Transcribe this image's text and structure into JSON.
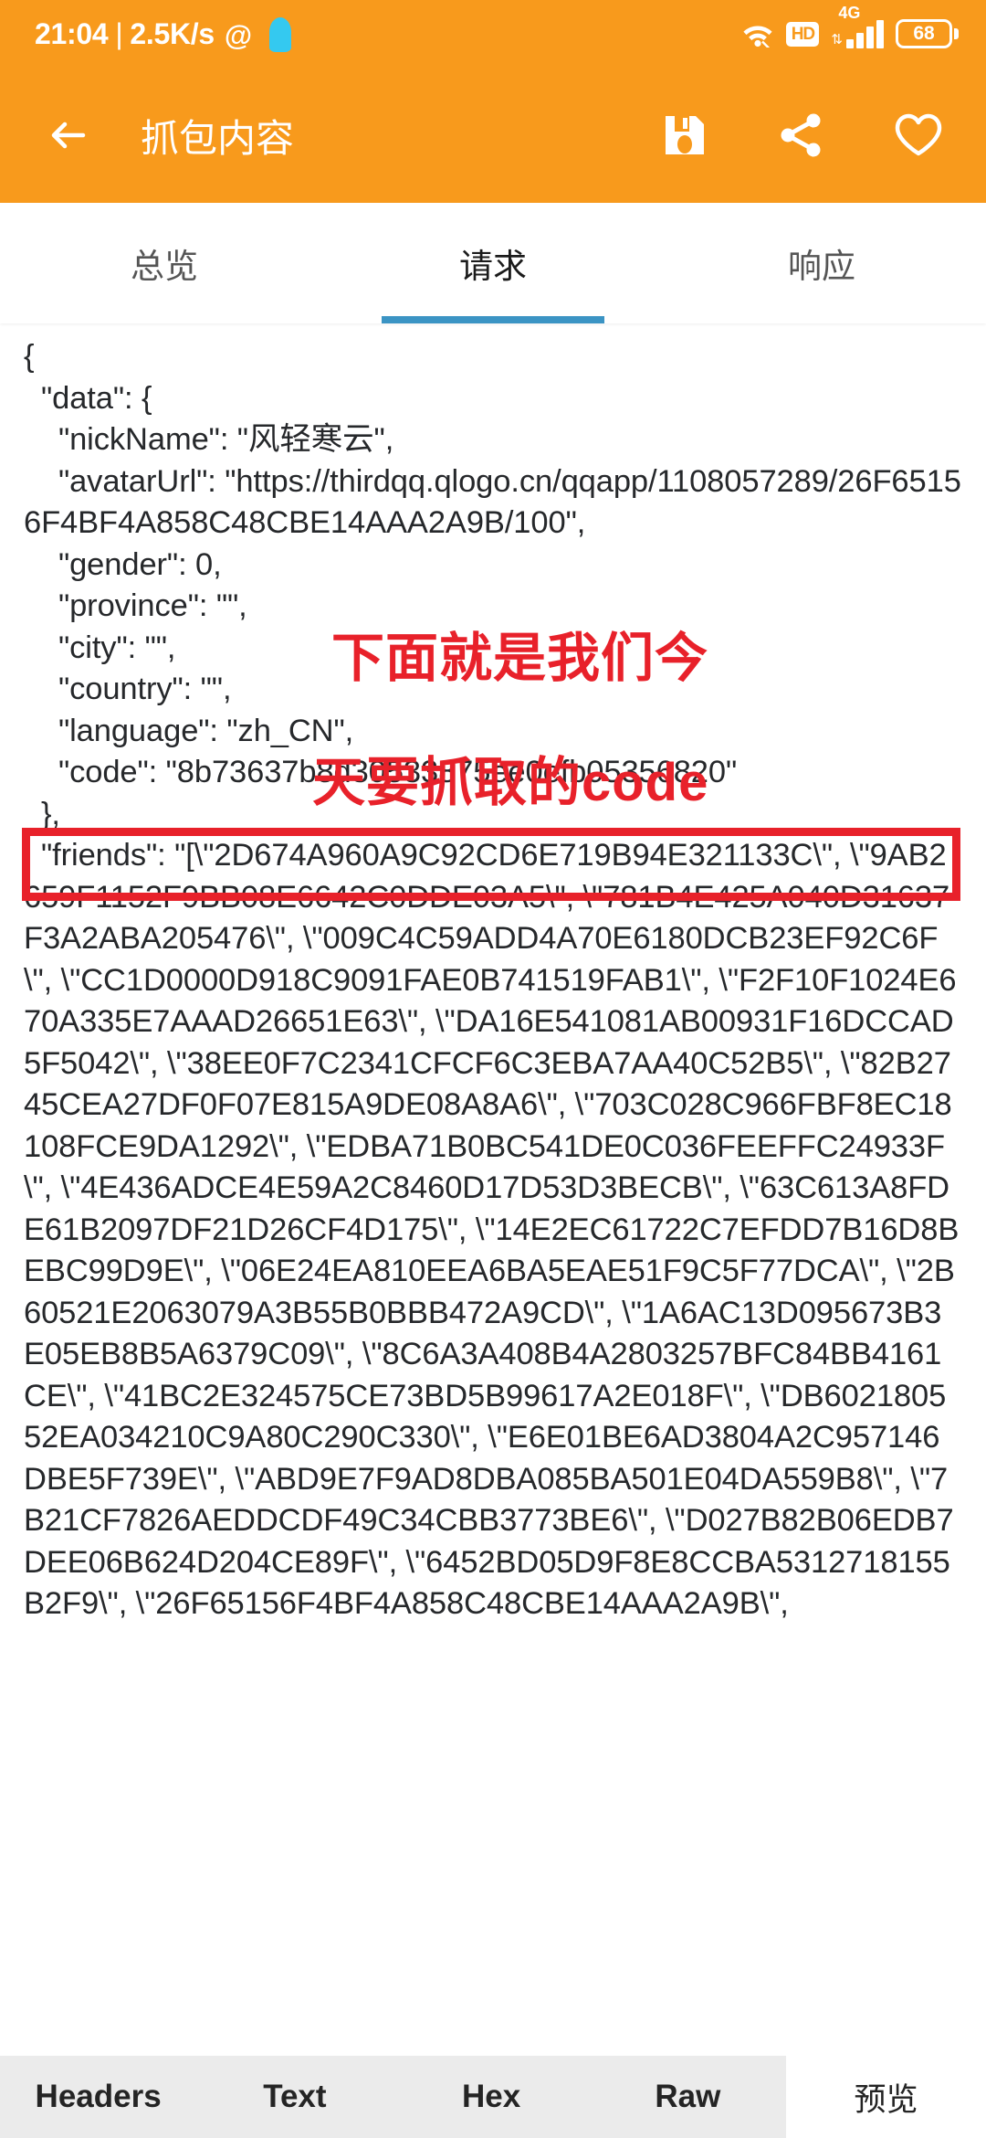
{
  "status_bar": {
    "time": "21:04",
    "separator": "|",
    "net_speed": "2.5K/s",
    "at_icon": "@",
    "qq_icon": "qq-penguin-icon",
    "wifi_icon": "wifi-icon",
    "hd_label": "HD",
    "network_type": "4G",
    "signal_icon": "signal-bars-icon",
    "battery_level": "68"
  },
  "app_bar": {
    "back_icon": "back-arrow-icon",
    "title": "抓包内容",
    "save_icon": "save-icon",
    "share_icon": "share-icon",
    "favorite_icon": "heart-icon"
  },
  "tabs": {
    "items": [
      {
        "label": "总览",
        "active": false
      },
      {
        "label": "请求",
        "active": true
      },
      {
        "label": "响应",
        "active": false
      }
    ],
    "active_index": 1,
    "indicator_color": "#3B94C4"
  },
  "annotations": {
    "color": "#E8212A",
    "line1": "下面就是我们今",
    "line2": "天要抓取的code",
    "highlight_target": "\"code\": \"8b73637b8d30533875ee0efb05356820\""
  },
  "request_body": {
    "text": "{\n  \"data\": {\n    \"nickName\": \"风轻寒云\",\n    \"avatarUrl\": \"https://thirdqq.qlogo.cn/qqapp/1108057289/26F65156F4BF4A858C48CBE14AAA2A9B/100\",\n    \"gender\": 0,\n    \"province\": \"\",\n    \"city\": \"\",\n    \"country\": \"\",\n    \"language\": \"zh_CN\",\n    \"code\": \"8b73637b8d30533875ee0efb05356820\"\n  },\n  \"friends\": \"[\\\"2D674A960A9C92CD6E719B94E321133C\\\", \\\"9AB2659F1152F9BB08E6642C0DDE03A5\\\", \\\"781B4E425A040D31637F3A2ABA205476\\\", \\\"009C4C59ADD4A70E6180DCB23EF92C6F\\\", \\\"CC1D0000D918C9091FAE0B741519FAB1\\\", \\\"F2F10F1024E670A335E7AAAD26651E63\\\", \\\"DA16E541081AB00931F16DCCAD5F5042\\\", \\\"38EE0F7C2341CFCF6C3EBA7AA40C52B5\\\", \\\"82B2745CEA27DF0F07E815A9DE08A8A6\\\", \\\"703C028C966FBF8EC18108FCE9DA1292\\\", \\\"EDBA71B0BC541DE0C036FEEFFC24933F\\\", \\\"4E436ADCE4E59A2C8460D17D53D3BECB\\\", \\\"63C613A8FDE61B2097DF21D26CF4D175\\\", \\\"14E2EC61722C7EFDD7B16D8BEBC99D9E\\\", \\\"06E24EA810EEA6BA5EAE51F9C5F77DCA\\\", \\\"2B60521E2063079A3B55B0BBB472A9CD\\\", \\\"1A6AC13D095673B3E05EB8B5A6379C09\\\", \\\"8C6A3A408B4A2803257BFC84BB4161CE\\\", \\\"41BC2E324575CE73BD5B99617A2E018F\\\", \\\"DB602180552EA034210C9A80C290C330\\\", \\\"E6E01BE6AD3804A2C957146DBE5F739E\\\", \\\"ABD9E7F9AD8DBA085BA501E04DA559B8\\\", \\\"7B21CF7826AEDDCDF49C34CBB3773BE6\\\", \\\"D027B82B06EDB7DEE06B624D204CE89F\\\", \\\"6452BD05D9F8E8CCBA5312718155B2F9\\\", \\\"26F65156F4BF4A858C48CBE14AAA2A9B\\\","
  },
  "bottom_bar": {
    "items": [
      {
        "label": "Headers",
        "active": false
      },
      {
        "label": "Text",
        "active": false
      },
      {
        "label": "Hex",
        "active": false
      },
      {
        "label": "Raw",
        "active": false
      },
      {
        "label": "预览",
        "active": true
      }
    ]
  }
}
